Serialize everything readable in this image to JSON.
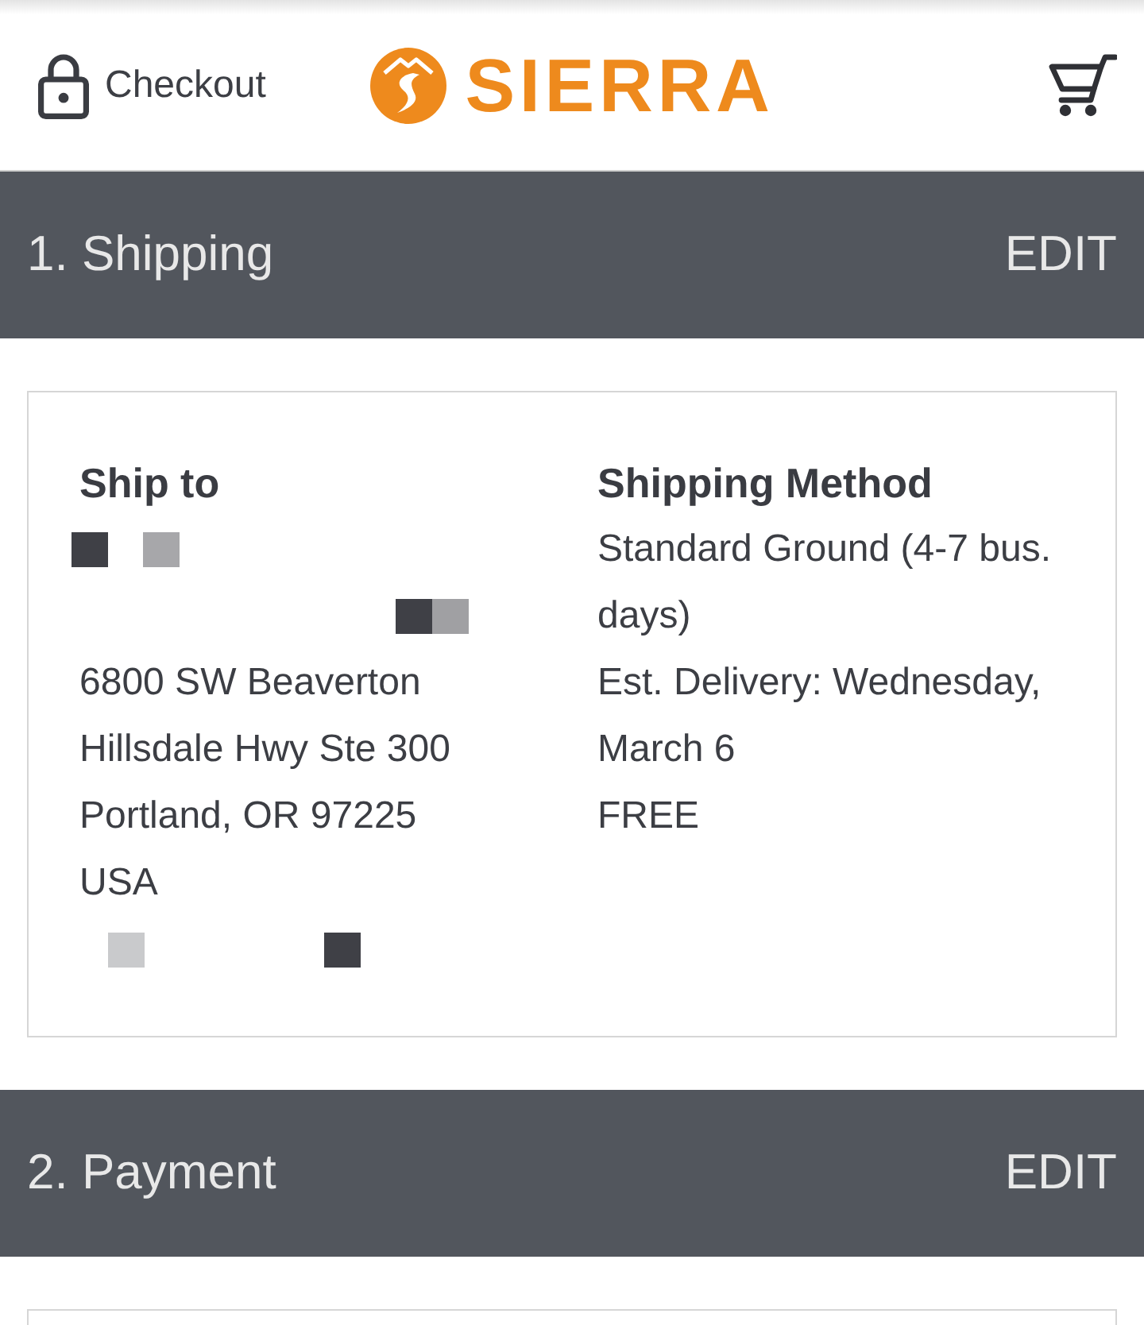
{
  "header": {
    "checkout": {
      "label": "Checkout"
    },
    "logo": {
      "text": "SIERRA"
    }
  },
  "sections": [
    {
      "title": "1. Shipping",
      "edit": "EDIT",
      "columns": [
        {
          "heading": "Ship to",
          "lines": [
            {
              "kind": "redacted",
              "blocks": [
                {
                  "color": "#3f4046"
                },
                {
                  "color": "#a7a7aa"
                }
              ]
            },
            {
              "kind": "redacted",
              "blocks": [
                {
                  "color": "#3f4046"
                },
                {
                  "color": "#a0a0a3"
                }
              ]
            },
            {
              "kind": "text",
              "text": "6800 SW Beaverton Hillsdale Hwy Ste 300"
            },
            {
              "kind": "text",
              "text": "Portland, OR 97225"
            },
            {
              "kind": "text",
              "text": "USA"
            },
            {
              "kind": "redacted",
              "blocks": [
                {
                  "color": "#c9cacc"
                },
                {
                  "color": "#3f4046"
                }
              ]
            }
          ]
        },
        {
          "heading": "Shipping Method",
          "lines": [
            {
              "kind": "text",
              "text": "Standard Ground (4-7 bus. days)"
            },
            {
              "kind": "text",
              "text": "Est. Delivery: Wednesday, March 6"
            },
            {
              "kind": "text",
              "text": "FREE"
            }
          ]
        }
      ]
    },
    {
      "title": "2. Payment",
      "edit": "EDIT"
    }
  ]
}
